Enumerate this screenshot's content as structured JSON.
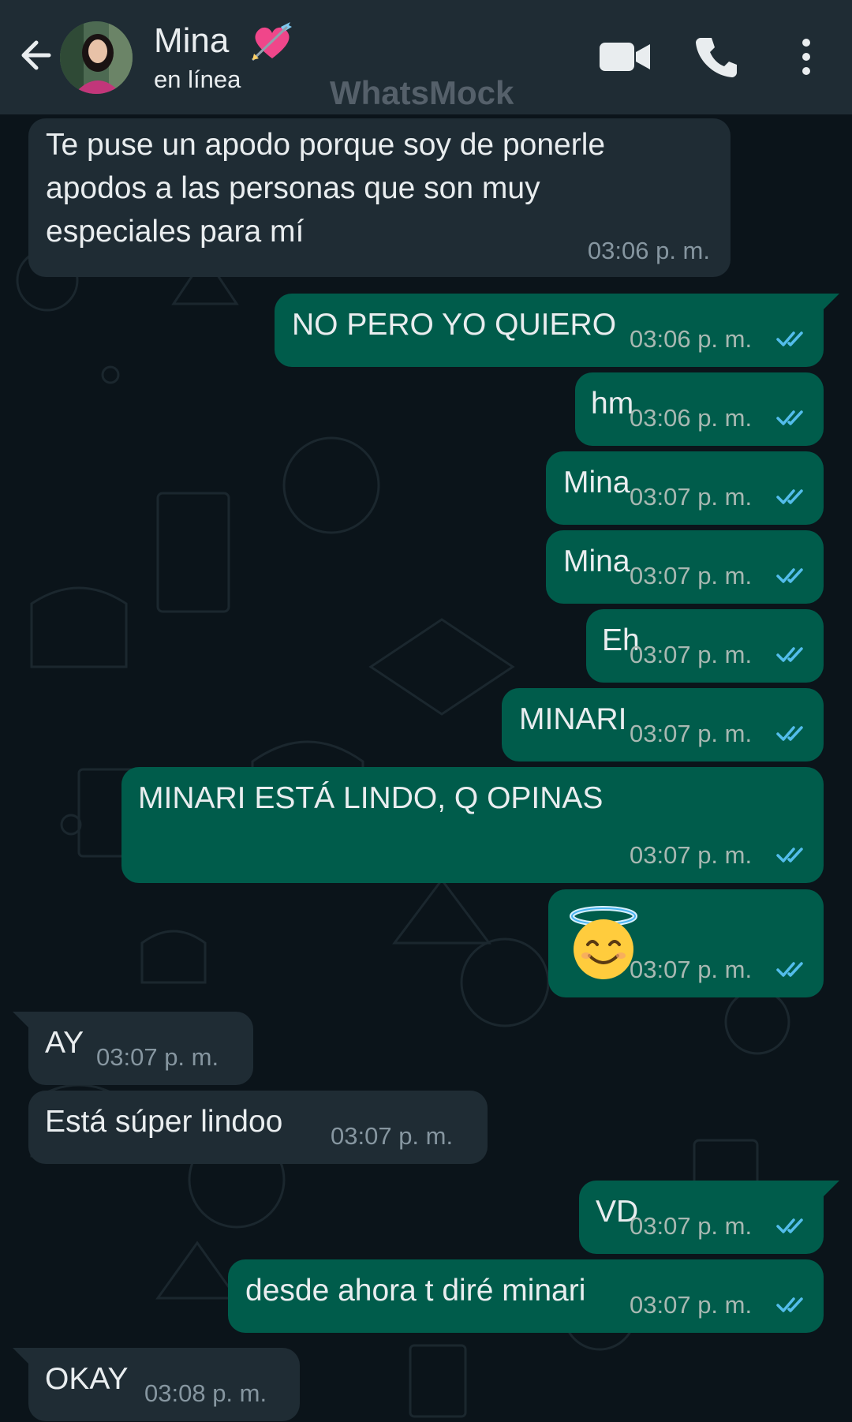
{
  "header": {
    "contact_name": "Mina",
    "status": "en línea",
    "watermark": "WhatsMock",
    "icons": {
      "back": "arrow-left-icon",
      "heart": "heart-with-arrow-icon",
      "video": "video-camera-icon",
      "call": "phone-icon",
      "more": "vertical-dots-icon"
    }
  },
  "colors": {
    "header_bg": "#1f2c34",
    "chat_bg": "#0b141a",
    "incoming_bubble": "#1f2c34",
    "outgoing_bubble": "#005c4b",
    "read_ticks": "#53bdeb",
    "text": "#e9edef"
  },
  "messages": [
    {
      "direction": "incoming",
      "lines": [
        "Te puse un apodo porque soy de ponerle",
        "apodos a las personas que son muy",
        "especiales para mí"
      ],
      "time": "03:06 p. m."
    },
    {
      "direction": "outgoing",
      "text": "NO PERO YO QUIERO",
      "time": "03:06 p. m.",
      "status": "read"
    },
    {
      "direction": "outgoing",
      "text": "hm",
      "time": "03:06 p. m.",
      "status": "read"
    },
    {
      "direction": "outgoing",
      "text": "Mina",
      "time": "03:07 p. m.",
      "status": "read"
    },
    {
      "direction": "outgoing",
      "text": "Mina",
      "time": "03:07 p. m.",
      "status": "read"
    },
    {
      "direction": "outgoing",
      "text": "Eh",
      "time": "03:07 p. m.",
      "status": "read"
    },
    {
      "direction": "outgoing",
      "text": "MINARI",
      "time": "03:07 p. m.",
      "status": "read"
    },
    {
      "direction": "outgoing",
      "text": "MINARI ESTÁ LINDO, Q OPINAS",
      "time": "03:07 p. m.",
      "status": "read"
    },
    {
      "direction": "outgoing",
      "emoji": "smiling-face-with-halo-icon",
      "time": "03:07 p. m.",
      "status": "read"
    },
    {
      "direction": "incoming",
      "text": "AY",
      "time": "03:07 p. m."
    },
    {
      "direction": "incoming",
      "text": "Está súper lindoo",
      "time": "03:07 p. m."
    },
    {
      "direction": "outgoing",
      "text": "VD",
      "time": "03:07 p. m.",
      "status": "read"
    },
    {
      "direction": "outgoing",
      "text": "desde ahora t diré minari",
      "time": "03:07 p. m.",
      "status": "read"
    },
    {
      "direction": "incoming",
      "text": "OKAY",
      "time": "03:08 p. m."
    }
  ]
}
